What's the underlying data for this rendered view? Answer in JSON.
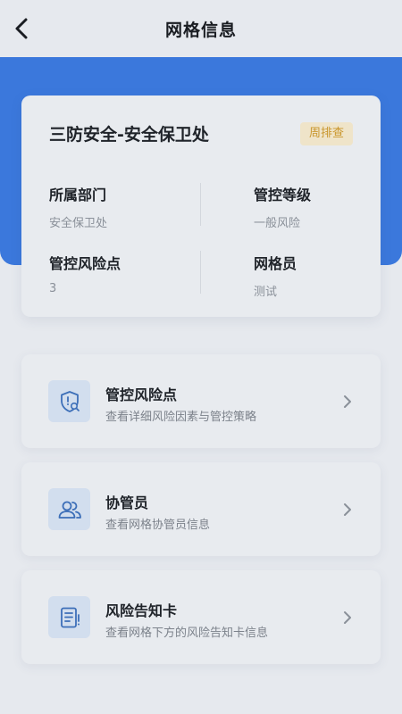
{
  "header": {
    "title": "网格信息",
    "back_icon": "chevron-left-icon"
  },
  "colors": {
    "brand_blue": "#3b78dc",
    "badge_text": "#c9962c",
    "badge_bg": "#efe4c9",
    "icon_bg": "#d2deee",
    "icon_stroke": "#3d6fb8"
  },
  "grid_card": {
    "title": "三防安全-安全保卫处",
    "badge": "周排查",
    "fields": [
      {
        "label": "所属部门",
        "value": "安全保卫处"
      },
      {
        "label": "管控等级",
        "value": "一般风险"
      },
      {
        "label": "管控风险点",
        "value": "3"
      },
      {
        "label": "网格员",
        "value": "测试"
      }
    ]
  },
  "menu": [
    {
      "title": "管控风险点",
      "subtitle": "查看详细风险因素与管控策略",
      "icon": "shield-search-icon"
    },
    {
      "title": "协管员",
      "subtitle": "查看网格协管员信息",
      "icon": "users-icon"
    },
    {
      "title": "风险告知卡",
      "subtitle": "查看网格下方的风险告知卡信息",
      "icon": "notice-card-icon"
    }
  ]
}
